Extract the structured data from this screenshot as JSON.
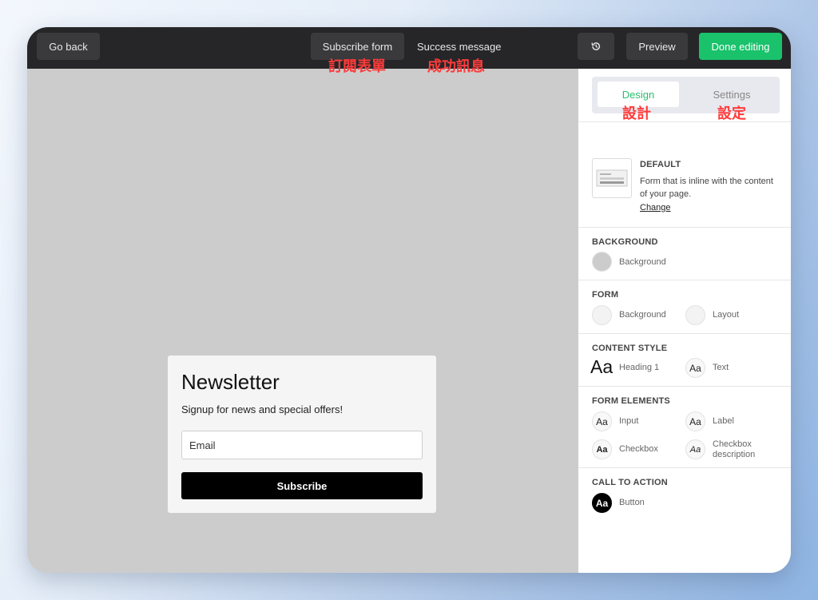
{
  "topbar": {
    "go_back": "Go back",
    "subscribe_form": "Subscribe form",
    "success_message": "Success message",
    "preview": "Preview",
    "done_editing": "Done editing"
  },
  "annotations": {
    "subscribe_form": "訂閱表單",
    "success_message": "成功訊息",
    "design": "設計",
    "settings": "設定"
  },
  "form": {
    "title": "Newsletter",
    "subtitle": "Signup for news and special offers!",
    "email_placeholder": "Email",
    "button": "Subscribe"
  },
  "panel": {
    "tabs": {
      "design": "Design",
      "settings": "Settings"
    },
    "default": {
      "title": "DEFAULT",
      "desc_line1": "Form that is inline with the content",
      "desc_line2": "of your page.",
      "change": "Change"
    },
    "background": {
      "title": "BACKGROUND",
      "item": "Background"
    },
    "form": {
      "title": "FORM",
      "background": "Background",
      "layout": "Layout"
    },
    "content_style": {
      "title": "CONTENT STYLE",
      "heading": "Heading 1",
      "text": "Text",
      "glyph": "Aa"
    },
    "form_elements": {
      "title": "FORM ELEMENTS",
      "input": "Input",
      "label": "Label",
      "checkbox": "Checkbox",
      "checkbox_desc_l1": "Checkbox",
      "checkbox_desc_l2": "description",
      "glyph": "Aa"
    },
    "cta": {
      "title": "CALL TO ACTION",
      "button": "Button",
      "glyph": "Aa"
    }
  },
  "colors": {
    "accent_green": "#19c26b",
    "annotation_red": "#ff3b3b",
    "background_swatch": "#cccccc"
  },
  "icons": {
    "history": "history-icon"
  }
}
